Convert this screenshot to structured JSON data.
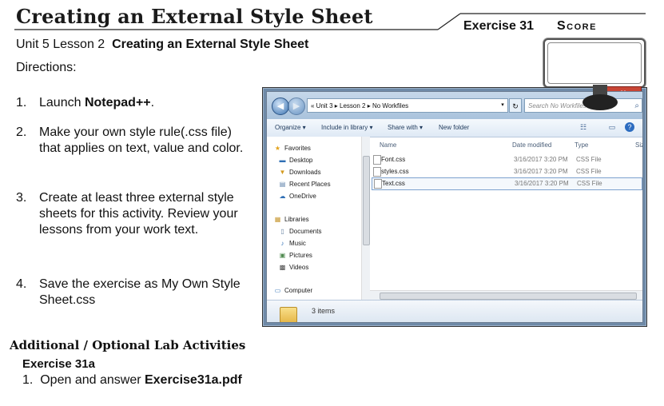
{
  "header": {
    "title": "Creating an External Style Sheet",
    "exercise": "Exercise 31",
    "score": "Score",
    "subtitle_unit": "Unit 5 Lesson 2",
    "subtitle_topic": "Creating an External Style Sheet",
    "directions": "Directions:"
  },
  "steps": [
    {
      "num": "1.",
      "text_before": "Launch ",
      "text_bold": "Notepad++",
      "text_after": "."
    },
    {
      "num": "2.",
      "text": "Make your own style rule(.css file) that applies on text, value and color."
    },
    {
      "num": "3.",
      "text": "Create at least three external style sheets for this activity. Review your lessons from your work text."
    },
    {
      "num": "4.",
      "text": "Save the exercise as My Own Style Sheet.css"
    }
  ],
  "explorer": {
    "address": "« Unit 3 ▸ Lesson 2 ▸ No Workfiles",
    "search_placeholder": "Search No Workfiles",
    "toolbar": {
      "organize": "Organize ▾",
      "include": "Include in library ▾",
      "share": "Share with ▾",
      "new_folder": "New folder"
    },
    "nav": {
      "favorites": "Favorites",
      "desktop": "Desktop",
      "downloads": "Downloads",
      "recent": "Recent Places",
      "onedrive": "OneDrive",
      "libraries": "Libraries",
      "documents": "Documents",
      "music": "Music",
      "pictures": "Pictures",
      "videos": "Videos",
      "computer": "Computer"
    },
    "columns": {
      "name": "Name",
      "date": "Date modified",
      "type": "Type",
      "size": "Size"
    },
    "files": [
      {
        "name": "Font.css",
        "date": "3/16/2017 3:20 PM",
        "type": "CSS File"
      },
      {
        "name": "styles.css",
        "date": "3/16/2017 3:20 PM",
        "type": "CSS File"
      },
      {
        "name": "Text.css",
        "date": "3/16/2017 3:20 PM",
        "type": "CSS File"
      }
    ],
    "item_count": "3 items"
  },
  "additional": {
    "heading": "Additional / Optional Lab Activities",
    "exercise": "Exercise 31a",
    "step_num": "1.",
    "step_text": "Open and answer ",
    "step_bold": "Exercise31a.pdf"
  },
  "colors": {
    "window_frame": "#6e8aa8",
    "selection": "#7da2ce"
  }
}
